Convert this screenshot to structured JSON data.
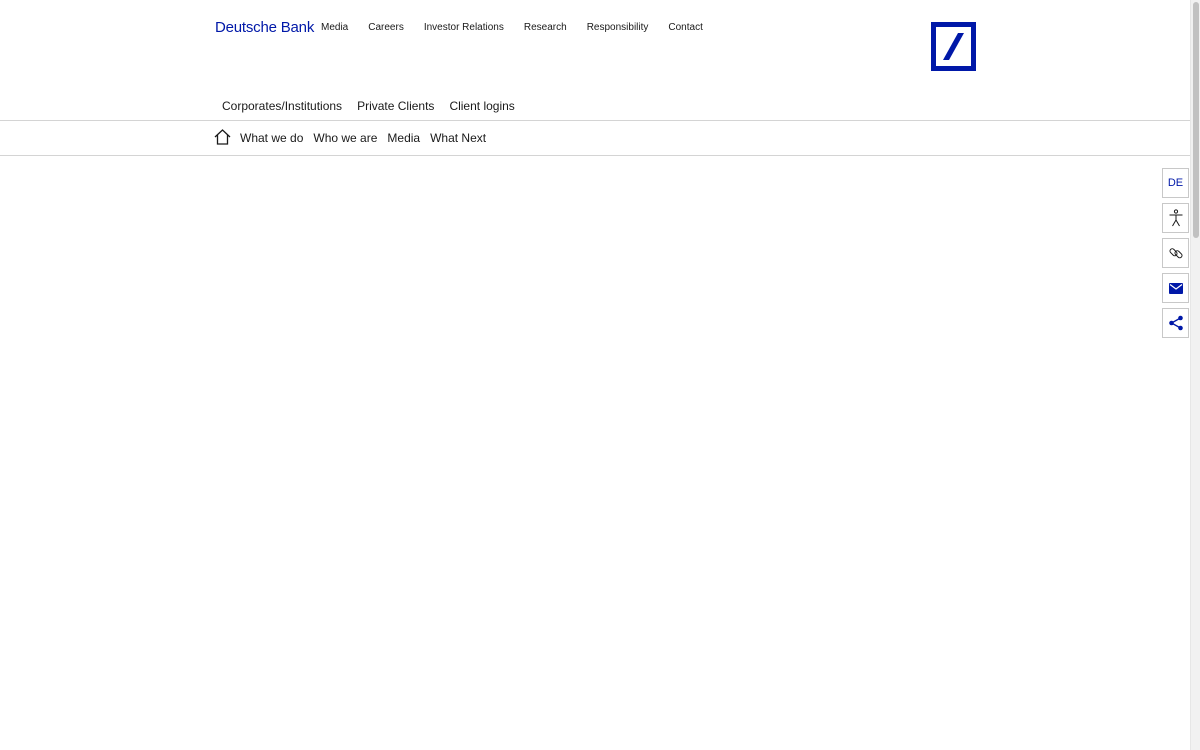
{
  "header": {
    "brand": "Deutsche Bank",
    "top_nav": [
      "Media",
      "Careers",
      "Investor Relations",
      "Research",
      "Responsibility",
      "Contact"
    ],
    "logo_icon": "deutsche-bank-slash-logo",
    "brand_color": "#0018a8"
  },
  "segment_nav": [
    "Corporates/Institutions",
    "Private Clients",
    "Client logins"
  ],
  "main_nav": {
    "home_icon": "home-icon",
    "items": [
      "What we do",
      "Who we are",
      "Media",
      "What Next"
    ]
  },
  "side_tools": {
    "language": "DE",
    "icons": [
      "accessibility-icon",
      "link-icon",
      "mail-icon",
      "share-icon"
    ]
  }
}
